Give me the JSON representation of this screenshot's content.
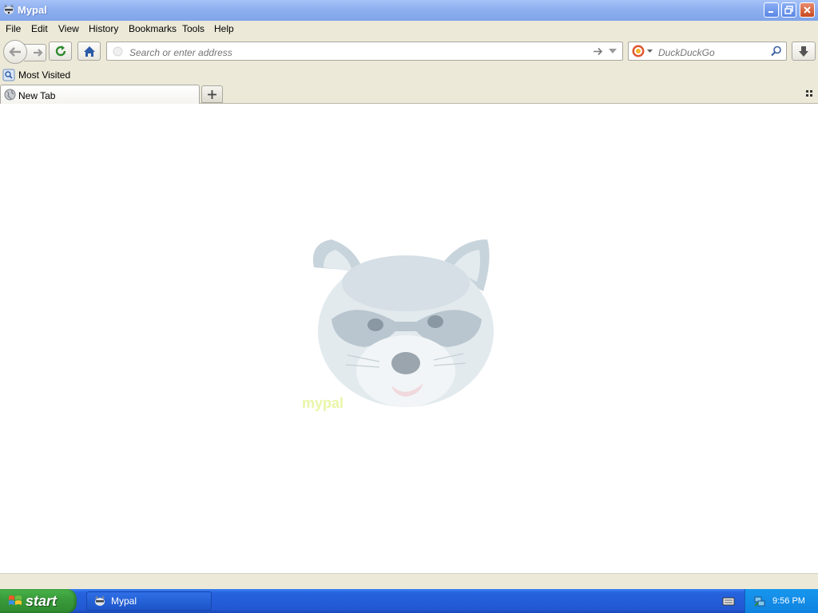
{
  "window": {
    "title": "Mypal"
  },
  "menu": {
    "items": [
      "File",
      "Edit",
      "View",
      "History",
      "Bookmarks",
      "Tools",
      "Help"
    ]
  },
  "nav": {
    "url_placeholder": "Search or enter address",
    "search_placeholder": "DuckDuckGo"
  },
  "bookmarks": {
    "items": [
      {
        "label": "Most Visited"
      }
    ]
  },
  "tabs": [
    {
      "label": "New Tab",
      "active": true
    }
  ],
  "content": {
    "watermark_text": "mypal",
    "watermark_color": "#e9f6a8"
  },
  "taskbar": {
    "start_label": "start",
    "tasks": [
      {
        "label": "Mypal"
      }
    ],
    "clock": "9:56 PM"
  },
  "colors": {
    "titlebar": "#8eb0f0",
    "taskbar": "#2258d2",
    "start_button": "#3a9c3c",
    "tray": "#0f82e0",
    "chrome": "#ece9d8"
  }
}
